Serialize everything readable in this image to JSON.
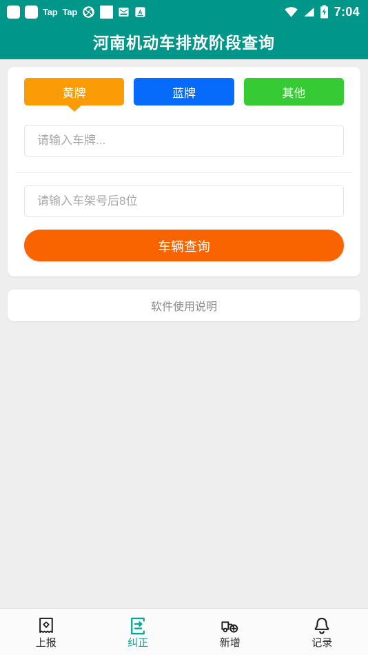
{
  "statusbar": {
    "left_items": [
      {
        "name": "app-square-icon-1",
        "type": "square",
        "label": ""
      },
      {
        "name": "app-square-icon-2",
        "type": "square",
        "label": ""
      },
      {
        "name": "tap-label-1",
        "type": "text",
        "label": "Tap"
      },
      {
        "name": "tap-label-2",
        "type": "text",
        "label": "Tap"
      },
      {
        "name": "swirl-icon",
        "type": "swirl",
        "label": ""
      },
      {
        "name": "app-square-icon-3",
        "type": "square-sharp",
        "label": ""
      },
      {
        "name": "mail-icon",
        "type": "mail",
        "label": ""
      },
      {
        "name": "translate-a-icon",
        "type": "letter-a",
        "label": "A"
      }
    ],
    "wifi_icon": "wifi-icon",
    "signal_icon": "signal-icon",
    "battery_icon": "battery-charging-icon",
    "time": "7:04"
  },
  "header": {
    "title": "河南机动车排放阶段查询",
    "background_color": "#00968a"
  },
  "search_card": {
    "tabs": [
      {
        "label": "黄牌",
        "color": "#fb9c06",
        "active": true
      },
      {
        "label": "蓝牌",
        "color": "#066bfb",
        "active": false
      },
      {
        "label": "其他",
        "color": "#36cb35",
        "active": false
      }
    ],
    "plate_input": {
      "value": "",
      "placeholder": "请输入车牌..."
    },
    "vin_input": {
      "value": "",
      "placeholder": "请输入车架号后8位"
    },
    "submit_label": "车辆查询",
    "submit_color": "#fa6400"
  },
  "help_card": {
    "label": "软件使用说明"
  },
  "bottom_nav": {
    "active_color": "#00a99a",
    "items": [
      {
        "label": "上报",
        "icon": "receipt-icon",
        "active": false
      },
      {
        "label": "纠正",
        "icon": "document-edit-icon",
        "active": true
      },
      {
        "label": "新增",
        "icon": "truck-add-icon",
        "active": false
      },
      {
        "label": "记录",
        "icon": "bell-icon",
        "active": false
      }
    ]
  }
}
